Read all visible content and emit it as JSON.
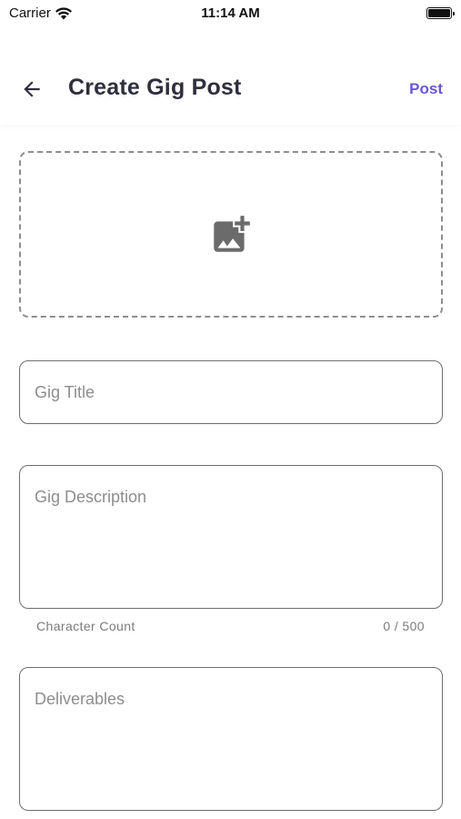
{
  "status_bar": {
    "carrier": "Carrier",
    "time": "11:14 AM",
    "battery_level": 1.0
  },
  "app_bar": {
    "title": "Create Gig Post",
    "action_label": "Post",
    "back_icon": "arrow-left-icon",
    "accent_color": "#6a57d3"
  },
  "image_upload": {
    "icon": "add-photo-icon"
  },
  "form": {
    "title_placeholder": "Gig Title",
    "title_value": "",
    "description_placeholder": "Gig Description",
    "description_value": "",
    "character_count_label": "Character Count",
    "character_count": "0 / 500",
    "deliverables_placeholder": "Deliverables",
    "deliverables_value": ""
  }
}
